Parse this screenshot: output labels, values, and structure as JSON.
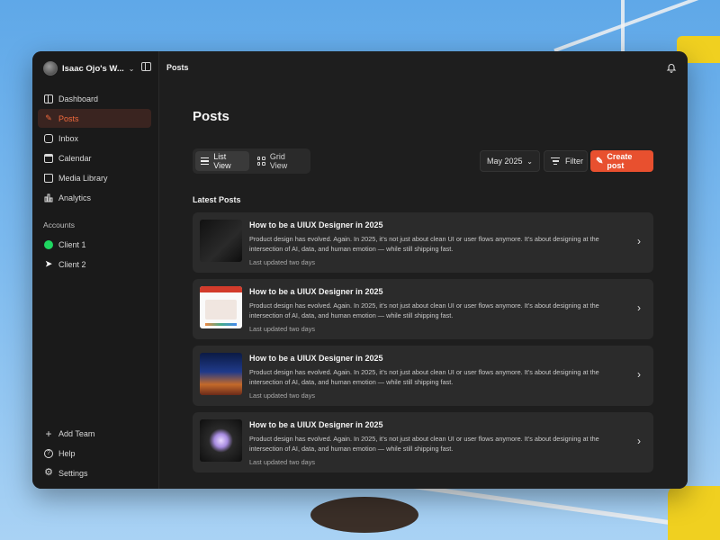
{
  "workspace": {
    "name": "Isaac Ojo's W..."
  },
  "topbar": {
    "title": "Posts"
  },
  "sidebar": {
    "nav": [
      {
        "label": "Dashboard",
        "icon": "dashboard-icon"
      },
      {
        "label": "Posts",
        "icon": "edit-icon"
      },
      {
        "label": "Inbox",
        "icon": "inbox-icon"
      },
      {
        "label": "Calendar",
        "icon": "calendar-icon"
      },
      {
        "label": "Media Library",
        "icon": "folder-icon"
      },
      {
        "label": "Analytics",
        "icon": "bar-chart-icon"
      }
    ],
    "accounts_label": "Accounts",
    "accounts": [
      {
        "label": "Client 1",
        "icon": "spotify-icon"
      },
      {
        "label": "Client 2",
        "icon": "puma-icon"
      }
    ],
    "bottom": [
      {
        "label": "Add Team",
        "icon": "plus-icon"
      },
      {
        "label": "Help",
        "icon": "help-icon"
      },
      {
        "label": "Settings",
        "icon": "gear-icon"
      }
    ]
  },
  "main": {
    "title": "Posts",
    "view_toggle": {
      "list": "List View",
      "grid": "Grid View"
    },
    "month": "May 2025",
    "filter": "Filter",
    "create": "Create post",
    "latest_label": "Latest Posts",
    "posts": [
      {
        "title": "How to be a UIUX Designer in 2025",
        "desc": "Product design has evolved. Again. In 2025, it’s not just about clean UI or user flows anymore. It’s about designing at the intersection of AI, data, and human emotion — while still shipping fast.",
        "meta": "Last updated two days"
      },
      {
        "title": "How to be a UIUX Designer in 2025",
        "desc": "Product design has evolved. Again. In 2025, it’s not just about clean UI or user flows anymore. It’s about designing at the intersection of AI, data, and human emotion — while still shipping fast.",
        "meta": "Last updated two days"
      },
      {
        "title": "How to be a UIUX Designer in 2025",
        "desc": "Product design has evolved. Again. In 2025, it’s not just about clean UI or user flows anymore. It’s about designing at the intersection of AI, data, and human emotion — while still shipping fast.",
        "meta": "Last updated two days"
      },
      {
        "title": "How to be a UIUX Designer in 2025",
        "desc": "Product design has evolved. Again. In 2025, it’s not just about clean UI or user flows anymore. It’s about designing at the intersection of AI, data, and human emotion — while still shipping fast.",
        "meta": "Last updated two days"
      }
    ]
  },
  "colors": {
    "accent": "#e8502f",
    "active_nav_text": "#f26a3d",
    "spotify": "#1ed760"
  }
}
